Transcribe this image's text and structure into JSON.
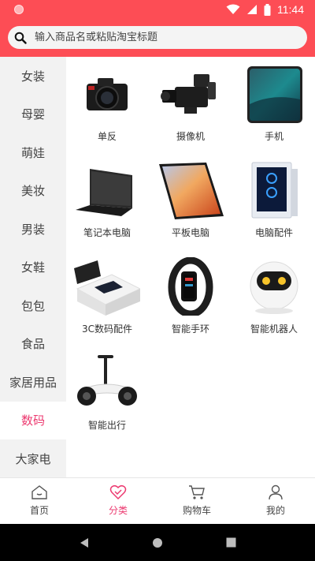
{
  "status_bar": {
    "time": "11:44"
  },
  "search": {
    "placeholder": "输入商品名或粘贴淘宝标题"
  },
  "sidebar": {
    "items": [
      {
        "label": "女装"
      },
      {
        "label": "母婴"
      },
      {
        "label": "萌娃"
      },
      {
        "label": "美妆"
      },
      {
        "label": "男装"
      },
      {
        "label": "女鞋"
      },
      {
        "label": "包包"
      },
      {
        "label": "食品"
      },
      {
        "label": "家居用品"
      },
      {
        "label": "数码"
      },
      {
        "label": "大家电"
      }
    ],
    "selected": "数码"
  },
  "products": [
    {
      "label": "单反",
      "icon": "dslr-camera-icon"
    },
    {
      "label": "摄像机",
      "icon": "video-camera-icon"
    },
    {
      "label": "手机",
      "icon": "smartphone-icon"
    },
    {
      "label": "笔记本电脑",
      "icon": "laptop-icon"
    },
    {
      "label": "平板电脑",
      "icon": "tablet-icon"
    },
    {
      "label": "电脑配件",
      "icon": "pc-case-icon"
    },
    {
      "label": "3C数码配件",
      "icon": "accessory-box-icon"
    },
    {
      "label": "智能手环",
      "icon": "smart-band-icon"
    },
    {
      "label": "智能机器人",
      "icon": "robot-icon"
    },
    {
      "label": "智能出行",
      "icon": "balance-scooter-icon"
    }
  ],
  "bottom_nav": {
    "items": [
      {
        "label": "首页",
        "icon": "home-icon"
      },
      {
        "label": "分类",
        "icon": "category-heart-icon"
      },
      {
        "label": "购物车",
        "icon": "cart-icon"
      },
      {
        "label": "我的",
        "icon": "user-icon"
      }
    ],
    "selected": "分类"
  },
  "colors": {
    "brand": "#fd4d55",
    "accent": "#ec3a70"
  }
}
